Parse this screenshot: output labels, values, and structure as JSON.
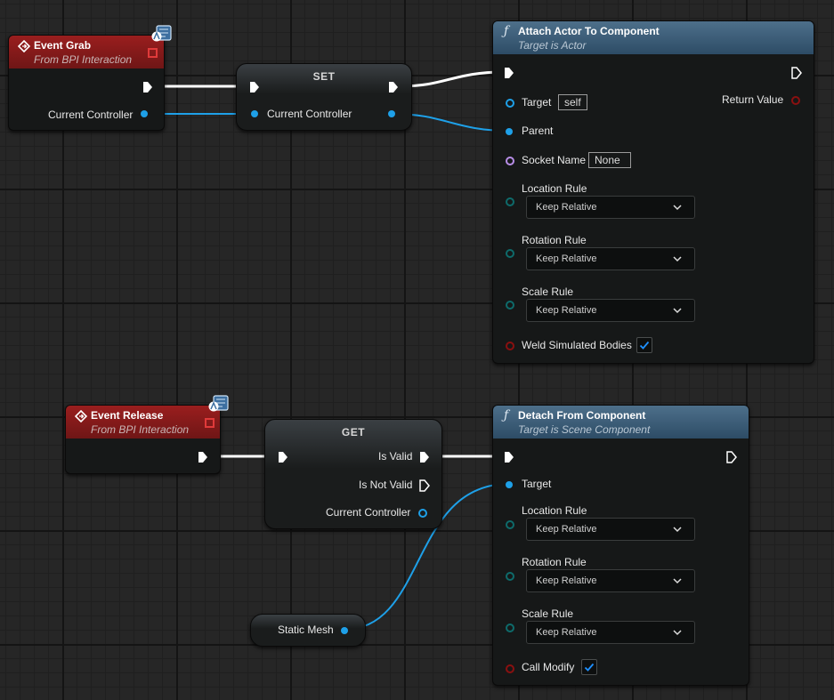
{
  "event_grab": {
    "title": "Event Grab",
    "subtitle": "From BPI Interaction",
    "pin_controller": "Current Controller"
  },
  "set_node": {
    "title": "SET",
    "pin_controller": "Current Controller"
  },
  "attach": {
    "title": "Attach Actor To Component",
    "subtitle": "Target is Actor",
    "target_label": "Target",
    "target_value": "self",
    "return_label": "Return Value",
    "parent_label": "Parent",
    "socket_label": "Socket Name",
    "socket_value": "None",
    "location_label": "Location Rule",
    "location_value": "Keep Relative",
    "rotation_label": "Rotation Rule",
    "rotation_value": "Keep Relative",
    "scale_label": "Scale Rule",
    "scale_value": "Keep Relative",
    "weld_label": "Weld Simulated Bodies",
    "weld_checked": true
  },
  "event_release": {
    "title": "Event Release",
    "subtitle": "From BPI Interaction"
  },
  "get_node": {
    "title": "GET",
    "is_valid": "Is Valid",
    "is_not_valid": "Is Not Valid",
    "pin_controller": "Current Controller"
  },
  "detach": {
    "title": "Detach From Component",
    "subtitle": "Target is Scene Component",
    "target_label": "Target",
    "location_label": "Location Rule",
    "location_value": "Keep Relative",
    "rotation_label": "Rotation Rule",
    "rotation_value": "Keep Relative",
    "scale_label": "Scale Rule",
    "scale_value": "Keep Relative",
    "call_modify_label": "Call Modify",
    "call_modify_checked": true
  },
  "static_mesh": {
    "label": "Static Mesh"
  },
  "colors": {
    "event_header": "#9a1e1e",
    "function_header": "#4d6f8a",
    "object_pin": "#1ea0e8",
    "exec_wire": "#ffffff"
  },
  "icons": {
    "event": "event-diamond-icon",
    "function": "function-f-icon",
    "interface_badge": "interface-badge-icon",
    "dropdown": "chevron-down-icon",
    "checkbox": "checkmark-icon"
  }
}
